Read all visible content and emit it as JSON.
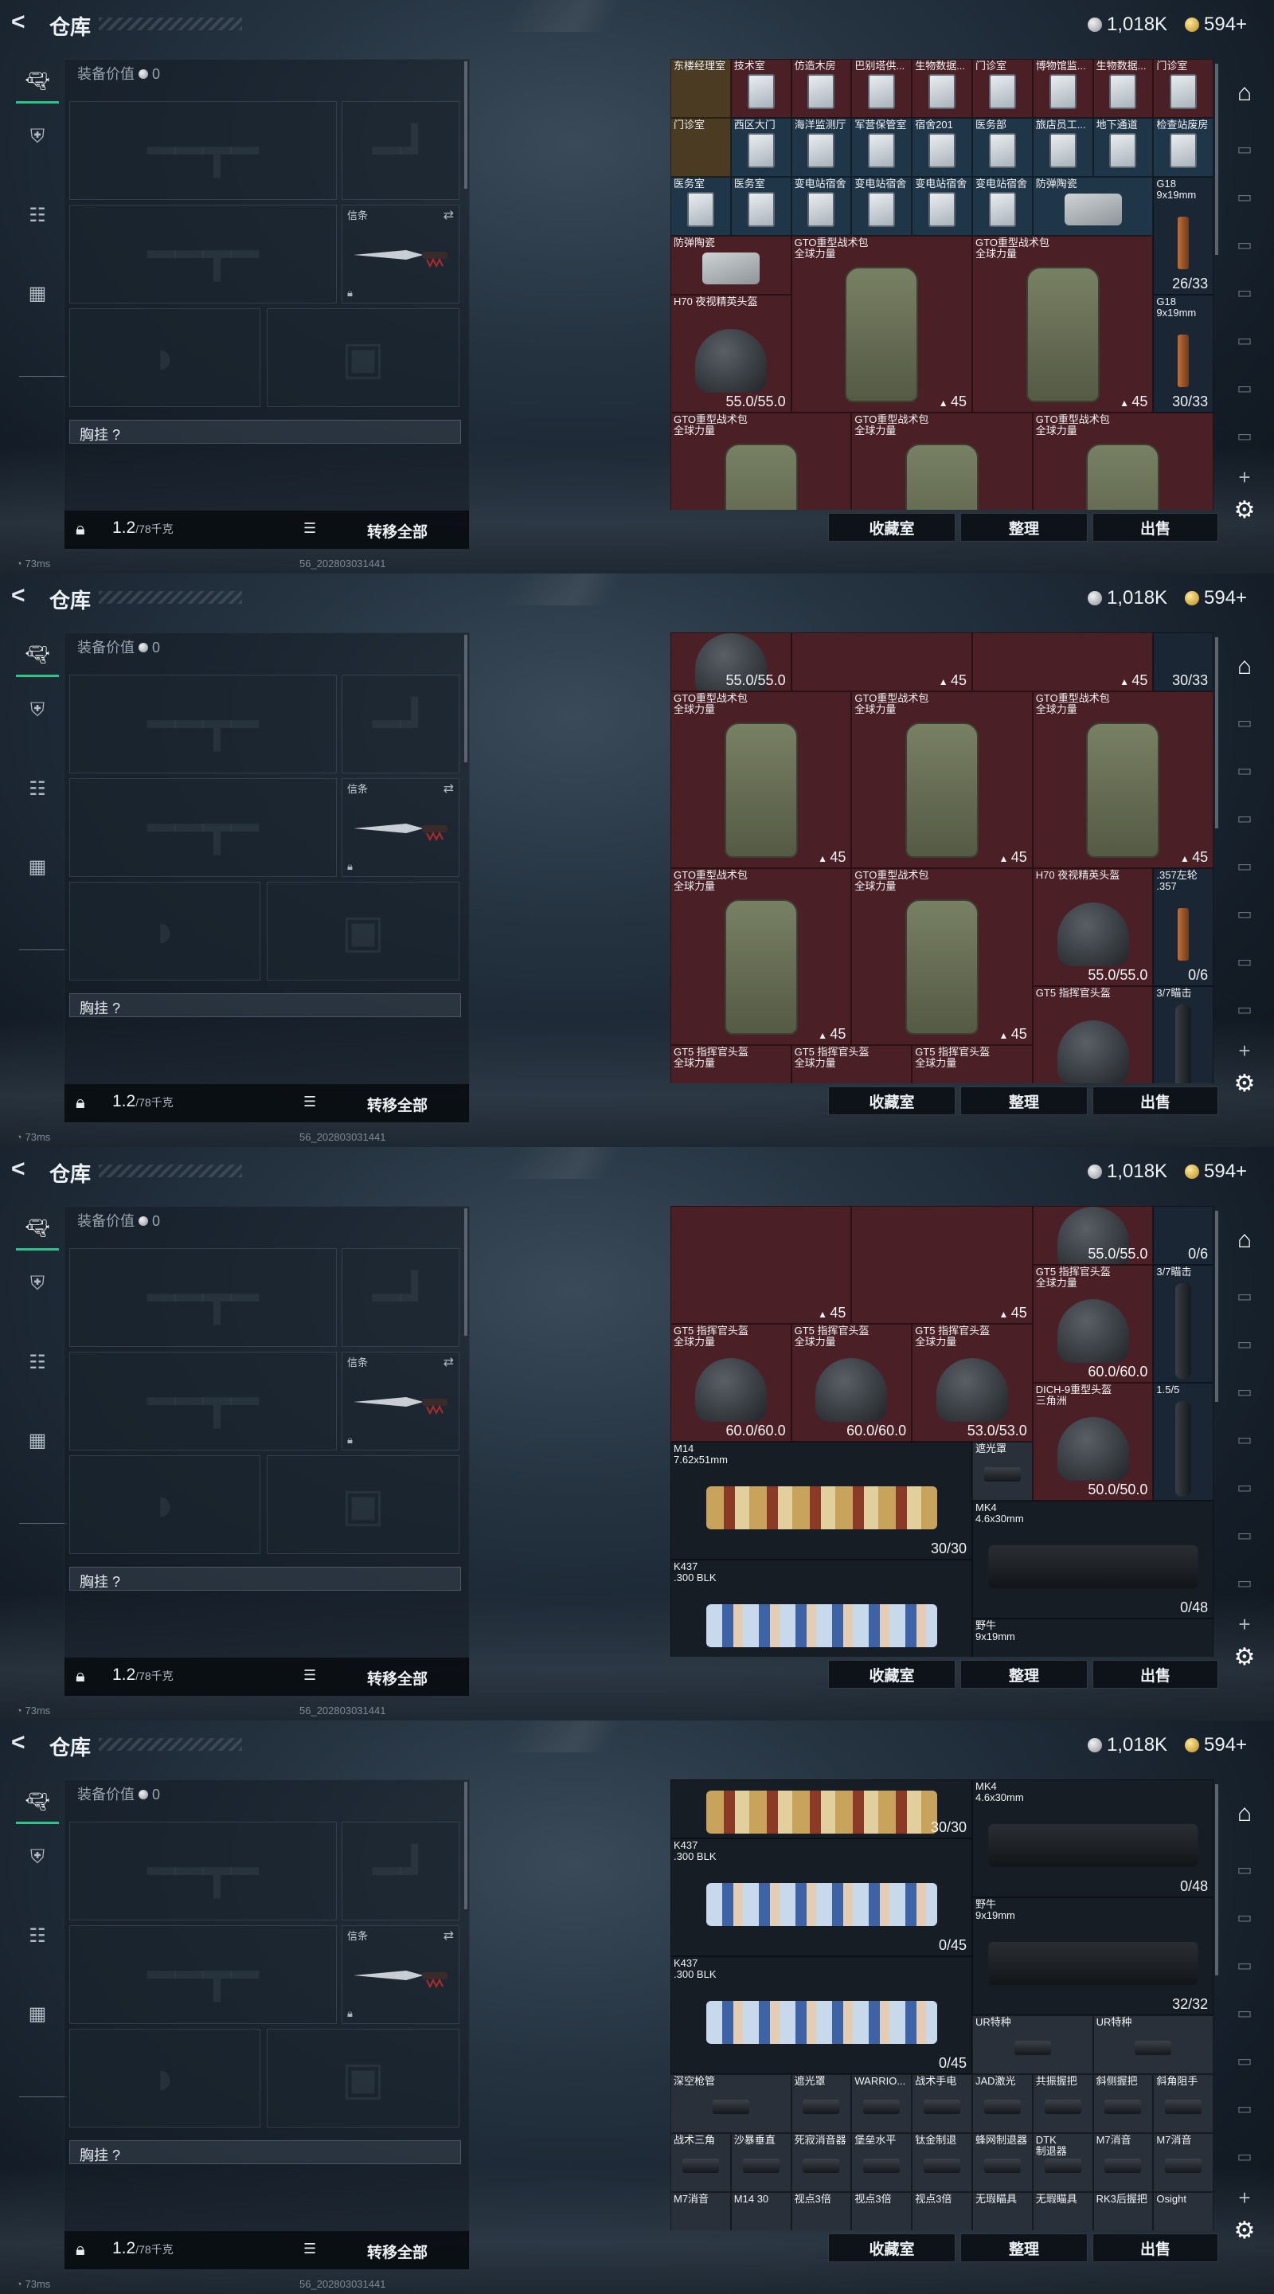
{
  "app": {
    "title": "仓库",
    "currency": {
      "silver": "1,018K",
      "gold": "594+"
    }
  },
  "loadout": {
    "equip_value_label": "装备价值",
    "equip_value": "0",
    "knife_label": "信条",
    "chest_label": "胸挂 ?",
    "weight": "1.2",
    "weight_max": "/78千克",
    "move_all": "转移全部"
  },
  "status": {
    "ping": "73ms",
    "serial": "56_202803031441"
  },
  "stash": {
    "collection": "收藏室",
    "sort": "整理",
    "sell": "出售"
  },
  "panels": [
    {
      "items": [
        {
          "n": "东楼经理室",
          "bg": "gold",
          "icon": "key",
          "c": 0,
          "r": 0
        },
        {
          "n": "技术室",
          "bg": "red",
          "icon": "card",
          "c": 1,
          "r": 0
        },
        {
          "n": "仿造木房",
          "bg": "red",
          "icon": "card",
          "c": 2,
          "r": 0
        },
        {
          "n": "巴别塔供...",
          "bg": "red",
          "icon": "card",
          "c": 3,
          "r": 0
        },
        {
          "n": "生物数据...",
          "bg": "red",
          "icon": "card",
          "c": 4,
          "r": 0
        },
        {
          "n": "门诊室",
          "bg": "red",
          "icon": "card",
          "c": 5,
          "r": 0
        },
        {
          "n": "博物馆监...",
          "bg": "red",
          "icon": "card",
          "c": 6,
          "r": 0
        },
        {
          "n": "生物数据...",
          "bg": "red",
          "icon": "card",
          "c": 7,
          "r": 0
        },
        {
          "n": "门诊室",
          "bg": "red",
          "icon": "card",
          "c": 8,
          "r": 0
        },
        {
          "n": "门诊室",
          "bg": "gold",
          "icon": "key",
          "c": 0,
          "r": 1
        },
        {
          "n": "西区大门",
          "bg": "blue",
          "icon": "card",
          "c": 1,
          "r": 1
        },
        {
          "n": "海洋监测厅",
          "bg": "blue",
          "icon": "card",
          "c": 2,
          "r": 1
        },
        {
          "n": "军营保管室",
          "bg": "blue",
          "icon": "card",
          "c": 3,
          "r": 1
        },
        {
          "n": "宿舍201",
          "bg": "blue",
          "icon": "card",
          "c": 4,
          "r": 1
        },
        {
          "n": "医务部",
          "bg": "blue",
          "icon": "card",
          "c": 5,
          "r": 1
        },
        {
          "n": "旅店员工...",
          "bg": "blue",
          "icon": "card",
          "c": 6,
          "r": 1
        },
        {
          "n": "地下通道",
          "bg": "blue",
          "icon": "card",
          "c": 7,
          "r": 1
        },
        {
          "n": "检查站废房",
          "bg": "blue",
          "icon": "card",
          "c": 8,
          "r": 1
        },
        {
          "n": "医务室",
          "bg": "blue",
          "icon": "card",
          "c": 0,
          "r": 2
        },
        {
          "n": "医务室",
          "bg": "blue",
          "icon": "card",
          "c": 1,
          "r": 2
        },
        {
          "n": "变电站宿舍",
          "bg": "blue",
          "icon": "card",
          "c": 2,
          "r": 2
        },
        {
          "n": "变电站宿舍",
          "bg": "blue",
          "icon": "card",
          "c": 3,
          "r": 2
        },
        {
          "n": "变电站宿舍",
          "bg": "blue",
          "icon": "card",
          "c": 4,
          "r": 2
        },
        {
          "n": "变电站宿舍",
          "bg": "blue",
          "icon": "card",
          "c": 5,
          "r": 2
        },
        {
          "n": "防弹陶瓷",
          "bg": "blue",
          "icon": "plate",
          "c": 6,
          "r": 2,
          "w": 2
        },
        {
          "n": "G18\n9x19mm",
          "bg": "dblue",
          "icon": "mag",
          "c": 8,
          "r": 2,
          "h": 2,
          "v": "26/33"
        },
        {
          "n": "防弹陶瓷",
          "bg": "red",
          "icon": "plate",
          "c": 0,
          "r": 3,
          "w": 2
        },
        {
          "n": "GTO重型战术包\n全球力量",
          "bg": "red",
          "icon": "pack",
          "c": 2,
          "r": 3,
          "w": 3,
          "h": 3,
          "v": "45",
          "vi": "bag"
        },
        {
          "n": "GTO重型战术包\n全球力量",
          "bg": "red",
          "icon": "pack",
          "c": 5,
          "r": 3,
          "w": 3,
          "h": 3,
          "v": "45",
          "vi": "bag"
        },
        {
          "n": "H70 夜视精英头盔",
          "bg": "red",
          "icon": "helm",
          "c": 0,
          "r": 4,
          "w": 2,
          "h": 2,
          "v": "55.0/55.0"
        },
        {
          "n": "G18\n9x19mm",
          "bg": "dblue",
          "icon": "mag",
          "c": 8,
          "r": 4,
          "h": 2,
          "v": "30/33"
        },
        {
          "n": "GTO重型战术包\n全球力量",
          "bg": "red",
          "icon": "pack",
          "c": 0,
          "r": 6,
          "w": 3,
          "h": 3
        },
        {
          "n": "GTO重型战术包\n全球力量",
          "bg": "red",
          "icon": "pack",
          "c": 3,
          "r": 6,
          "w": 3,
          "h": 3
        },
        {
          "n": "GTO重型战术包\n全球力量",
          "bg": "red",
          "icon": "pack",
          "c": 6,
          "r": 6,
          "w": 3,
          "h": 3
        }
      ]
    },
    {
      "items": [
        {
          "n": "",
          "bg": "red",
          "icon": "helm",
          "c": 0,
          "r": 0,
          "w": 2,
          "h": 1,
          "v": "55.0/55.0"
        },
        {
          "n": "",
          "bg": "red",
          "icon": "",
          "c": 2,
          "r": 0,
          "w": 3,
          "h": 1,
          "v": "45",
          "vi": "bag"
        },
        {
          "n": "",
          "bg": "red",
          "icon": "",
          "c": 5,
          "r": 0,
          "w": 3,
          "h": 1,
          "v": "45",
          "vi": "bag"
        },
        {
          "n": "",
          "bg": "dblue",
          "icon": "",
          "c": 8,
          "r": 0,
          "v": "30/33"
        },
        {
          "n": "GTO重型战术包\n全球力量",
          "bg": "red",
          "icon": "pack",
          "c": 0,
          "r": 1,
          "w": 3,
          "h": 3,
          "v": "45",
          "vi": "bag"
        },
        {
          "n": "GTO重型战术包\n全球力量",
          "bg": "red",
          "icon": "pack",
          "c": 3,
          "r": 1,
          "w": 3,
          "h": 3,
          "v": "45",
          "vi": "bag"
        },
        {
          "n": "GTO重型战术包\n全球力量",
          "bg": "red",
          "icon": "pack",
          "c": 6,
          "r": 1,
          "w": 3,
          "h": 3,
          "v": "45",
          "vi": "bag"
        },
        {
          "n": "GTO重型战术包\n全球力量",
          "bg": "red",
          "icon": "pack",
          "c": 0,
          "r": 4,
          "w": 3,
          "h": 3,
          "v": "45",
          "vi": "bag"
        },
        {
          "n": "GTO重型战术包\n全球力量",
          "bg": "red",
          "icon": "pack",
          "c": 3,
          "r": 4,
          "w": 3,
          "h": 3,
          "v": "45",
          "vi": "bag"
        },
        {
          "n": "H70 夜视精英头盔",
          "bg": "red",
          "icon": "helm",
          "c": 6,
          "r": 4,
          "w": 2,
          "h": 2,
          "v": "55.0/55.0"
        },
        {
          "n": ".357左轮\n.357",
          "bg": "dblue",
          "icon": "mag",
          "c": 8,
          "r": 4,
          "h": 2,
          "v": "0/6"
        },
        {
          "n": "GT5 指挥官头盔",
          "bg": "red",
          "icon": "helm",
          "c": 6,
          "r": 6,
          "w": 2,
          "h": 2
        },
        {
          "n": "3/7瞄击",
          "bg": "dblue",
          "icon": "scope",
          "c": 8,
          "r": 6,
          "h": 2
        },
        {
          "n": "GT5 指挥官头盔\n全球力量",
          "bg": "red",
          "icon": "",
          "c": 0,
          "r": 7,
          "w": 2,
          "h": 1
        },
        {
          "n": "GT5 指挥官头盔\n全球力量",
          "bg": "red",
          "icon": "",
          "c": 2,
          "r": 7,
          "w": 2,
          "h": 1
        },
        {
          "n": "GT5 指挥官头盔\n全球力量",
          "bg": "red",
          "icon": "",
          "c": 4,
          "r": 7,
          "w": 2,
          "h": 1
        }
      ]
    },
    {
      "items": [
        {
          "n": "",
          "bg": "red",
          "icon": "",
          "c": 0,
          "r": 0,
          "w": 3,
          "h": 2,
          "v": "45",
          "vi": "bag"
        },
        {
          "n": "",
          "bg": "red",
          "icon": "",
          "c": 3,
          "r": 0,
          "w": 3,
          "h": 2,
          "v": "45",
          "vi": "bag"
        },
        {
          "n": "",
          "bg": "red",
          "icon": "helm",
          "c": 6,
          "r": 0,
          "w": 2,
          "h": 1,
          "v": "55.0/55.0"
        },
        {
          "n": "",
          "bg": "dblue",
          "icon": "",
          "c": 8,
          "r": 0,
          "v": "0/6"
        },
        {
          "n": "GT5 指挥官头盔\n全球力量",
          "bg": "red",
          "icon": "helm",
          "c": 6,
          "r": 1,
          "w": 2,
          "h": 2,
          "v": "60.0/60.0"
        },
        {
          "n": "3/7瞄击",
          "bg": "dblue",
          "icon": "scope",
          "c": 8,
          "r": 1,
          "h": 2
        },
        {
          "n": "GT5 指挥官头盔\n全球力量",
          "bg": "red",
          "icon": "helm",
          "c": 0,
          "r": 2,
          "w": 2,
          "h": 2,
          "v": "60.0/60.0"
        },
        {
          "n": "GT5 指挥官头盔\n全球力量",
          "bg": "red",
          "icon": "helm",
          "c": 2,
          "r": 2,
          "w": 2,
          "h": 2,
          "v": "60.0/60.0"
        },
        {
          "n": "GT5 指挥官头盔\n全球力量",
          "bg": "red",
          "icon": "helm",
          "c": 4,
          "r": 2,
          "w": 2,
          "h": 2,
          "v": "53.0/53.0"
        },
        {
          "n": "DICH-9重型头盔\n三角洲",
          "bg": "red",
          "icon": "helm",
          "c": 6,
          "r": 3,
          "w": 2,
          "h": 2,
          "v": "50.0/50.0"
        },
        {
          "n": "1.5/5",
          "bg": "dblue",
          "icon": "scope",
          "c": 8,
          "r": 3,
          "h": 2
        },
        {
          "n": "M14\n7.62x51mm",
          "bg": "dark",
          "icon": "gun camo",
          "c": 0,
          "r": 4,
          "w": 5,
          "h": 2,
          "v": "30/30"
        },
        {
          "n": "遮光罩",
          "bg": "gray",
          "icon": "att",
          "c": 5,
          "r": 4
        },
        {
          "n": "MK4\n4.6x30mm",
          "bg": "dark",
          "icon": "gun black",
          "c": 5,
          "r": 5,
          "w": 4,
          "h": 2,
          "v": "0/48"
        },
        {
          "n": "K437\n.300 BLK",
          "bg": "dark",
          "icon": "gun blue",
          "c": 0,
          "r": 6,
          "w": 5,
          "h": 2
        },
        {
          "n": "野牛\n9x19mm",
          "bg": "dark",
          "icon": "",
          "c": 5,
          "r": 7,
          "w": 4,
          "h": 1
        }
      ]
    },
    {
      "items": [
        {
          "n": "",
          "bg": "dark",
          "icon": "gun camo",
          "c": 0,
          "r": 0,
          "w": 5,
          "h": 1,
          "v": "30/30"
        },
        {
          "n": "MK4\n4.6x30mm",
          "bg": "dark",
          "icon": "gun black",
          "c": 5,
          "r": 0,
          "w": 4,
          "h": 2,
          "v": "0/48"
        },
        {
          "n": "K437\n.300 BLK",
          "bg": "dark",
          "icon": "gun blue",
          "c": 0,
          "r": 1,
          "w": 5,
          "h": 2,
          "v": "0/45"
        },
        {
          "n": "野牛\n9x19mm",
          "bg": "dark",
          "icon": "gun black",
          "c": 5,
          "r": 2,
          "w": 4,
          "h": 2,
          "v": "32/32"
        },
        {
          "n": "K437\n.300 BLK",
          "bg": "dark",
          "icon": "gun blue",
          "c": 0,
          "r": 3,
          "w": 5,
          "h": 2,
          "v": "0/45"
        },
        {
          "n": "UR特种",
          "bg": "gray",
          "icon": "att",
          "c": 5,
          "r": 4,
          "w": 2
        },
        {
          "n": "UR特种",
          "bg": "gray",
          "icon": "att",
          "c": 7,
          "r": 4,
          "w": 2
        },
        {
          "n": "深空枪管",
          "bg": "gray",
          "icon": "att",
          "c": 0,
          "r": 5,
          "w": 2
        },
        {
          "n": "遮光罩",
          "bg": "gray",
          "icon": "att",
          "c": 2,
          "r": 5
        },
        {
          "n": "WARRIO...",
          "bg": "gray",
          "icon": "att",
          "c": 3,
          "r": 5
        },
        {
          "n": "战术手电",
          "bg": "gray",
          "icon": "att",
          "c": 4,
          "r": 5
        },
        {
          "n": "JAD激光",
          "bg": "gray",
          "icon": "att",
          "c": 5,
          "r": 5
        },
        {
          "n": "共振握把",
          "bg": "gray",
          "icon": "att",
          "c": 6,
          "r": 5
        },
        {
          "n": "斜侧握把",
          "bg": "gray",
          "icon": "att",
          "c": 7,
          "r": 5
        },
        {
          "n": "斜角阻手",
          "bg": "gray",
          "icon": "att",
          "c": 8,
          "r": 5
        },
        {
          "n": "战术三角",
          "bg": "gray",
          "icon": "att",
          "c": 0,
          "r": 6
        },
        {
          "n": "沙暴垂直",
          "bg": "gray",
          "icon": "att",
          "c": 1,
          "r": 6
        },
        {
          "n": "死寂消音器",
          "bg": "gray",
          "icon": "att",
          "c": 2,
          "r": 6
        },
        {
          "n": "堡垒水平",
          "bg": "gray",
          "icon": "att",
          "c": 3,
          "r": 6
        },
        {
          "n": "钛金制退",
          "bg": "gray",
          "icon": "att",
          "c": 4,
          "r": 6
        },
        {
          "n": "蜂网制退器",
          "bg": "gray",
          "icon": "att",
          "c": 5,
          "r": 6
        },
        {
          "n": "DTK\n制退器",
          "bg": "gray",
          "icon": "att",
          "c": 6,
          "r": 6
        },
        {
          "n": "M7消音",
          "bg": "gray",
          "icon": "att",
          "c": 7,
          "r": 6
        },
        {
          "n": "M7消音",
          "bg": "gray",
          "icon": "att",
          "c": 8,
          "r": 6
        },
        {
          "n": "M7消音",
          "bg": "gray",
          "icon": "",
          "c": 0,
          "r": 7
        },
        {
          "n": "M14 30",
          "bg": "gray",
          "icon": "",
          "c": 1,
          "r": 7
        },
        {
          "n": "视点3倍",
          "bg": "gray",
          "icon": "",
          "c": 2,
          "r": 7
        },
        {
          "n": "视点3倍",
          "bg": "gray",
          "icon": "",
          "c": 3,
          "r": 7
        },
        {
          "n": "视点3倍",
          "bg": "gray",
          "icon": "",
          "c": 4,
          "r": 7
        },
        {
          "n": "无瑕瞄具",
          "bg": "gray",
          "icon": "",
          "c": 5,
          "r": 7
        },
        {
          "n": "无瑕瞄具",
          "bg": "gray",
          "icon": "",
          "c": 6,
          "r": 7
        },
        {
          "n": "RK3后握把",
          "bg": "gray",
          "icon": "",
          "c": 7,
          "r": 7
        },
        {
          "n": "Osight",
          "bg": "gray",
          "icon": "",
          "c": 8,
          "r": 7
        }
      ]
    }
  ]
}
